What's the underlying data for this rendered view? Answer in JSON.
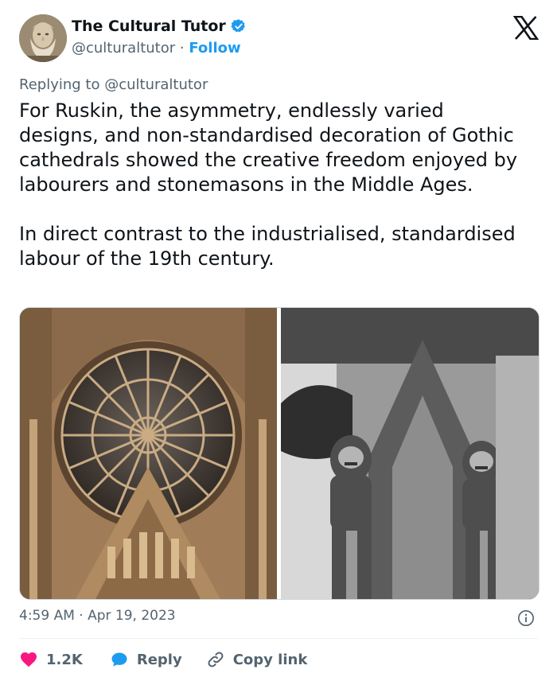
{
  "author": {
    "name": "The Cultural Tutor",
    "handle": "@culturaltutor",
    "separator": "·",
    "follow_label": "Follow",
    "verified": true,
    "avatar_icon": "bust-portrait-avatar"
  },
  "reply_context": "Replying to @culturaltutor",
  "tweet": {
    "paragraph1": "For Ruskin, the asymmetry, endlessly varied designs, and non-standardised decoration of Gothic cathedrals showed the creative freedom enjoyed by labourers and stonemasons in the Middle Ages.",
    "paragraph2": "In direct contrast to the industrialised, standardised labour of the 19th century."
  },
  "media": {
    "left_image": "gothic-rose-window-photo",
    "right_image": "stone-gargoyles-photo"
  },
  "timestamp": "4:59 AM · Apr 19, 2023",
  "actions": {
    "like_count": "1.2K",
    "reply_label": "Reply",
    "copy_label": "Copy link"
  },
  "colors": {
    "accent": "#1d9bf0",
    "like": "#f91880",
    "muted": "#536471"
  }
}
